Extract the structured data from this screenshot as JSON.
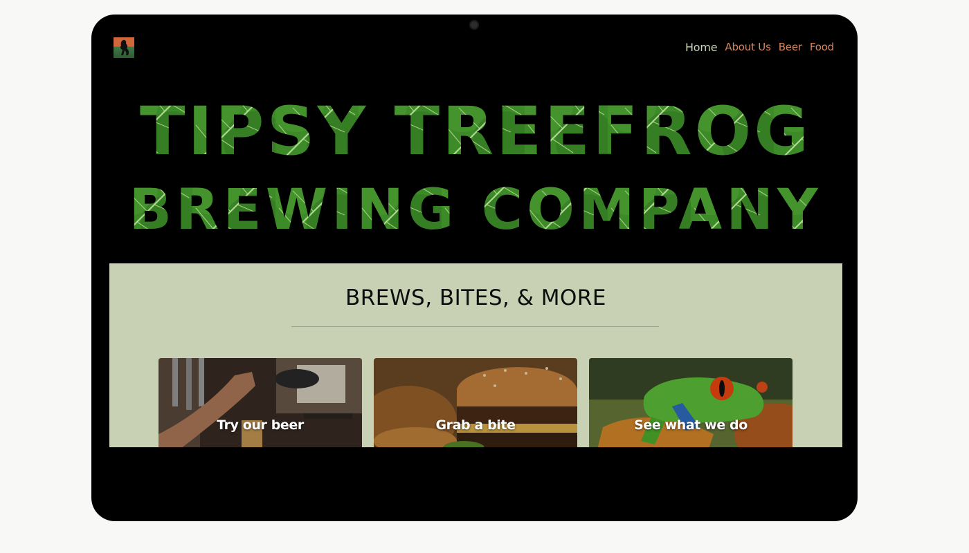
{
  "nav": {
    "items": [
      {
        "label": "Home",
        "active": true
      },
      {
        "label": "About Us",
        "active": false
      },
      {
        "label": "Beer",
        "active": false
      },
      {
        "label": "Food",
        "active": false
      }
    ]
  },
  "hero": {
    "line1": "TIPSY TREEFROG",
    "line2": "BREWING COMPANY"
  },
  "section": {
    "title": "BREWS, BITES, & MORE"
  },
  "cards": [
    {
      "label": "Try our beer"
    },
    {
      "label": "Grab a bite"
    },
    {
      "label": "See what we do"
    }
  ],
  "colors": {
    "nav_link": "#d9845a",
    "nav_active": "#c9d3b5",
    "leaf_green": "#3f8c2a",
    "section_bg": "#c8d1b4"
  }
}
